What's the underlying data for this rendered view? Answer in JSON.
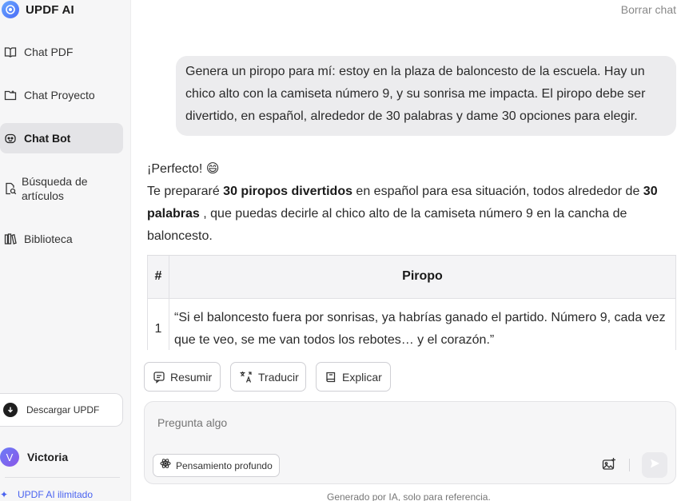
{
  "brand": {
    "name": "UPDF AI"
  },
  "sidebar": {
    "items": [
      {
        "label": "Chat PDF",
        "icon": "book-open-icon"
      },
      {
        "label": "Chat Proyecto",
        "icon": "folder-icon"
      },
      {
        "label": "Chat Bot",
        "icon": "bot-icon",
        "active": true
      },
      {
        "label_line1": "Búsqueda de",
        "label_line2": "artículos",
        "icon": "document-search-icon"
      },
      {
        "label": "Biblioteca",
        "icon": "library-icon"
      }
    ],
    "download_label": "Descargar UPDF",
    "user": {
      "initial": "V",
      "name": "Victoria"
    },
    "upgrade_label": "UPDF AI ilimitado"
  },
  "header": {
    "clear_chat": "Borrar chat"
  },
  "conversation": {
    "user_message": "Genera un piropo para mí: estoy en la plaza de baloncesto de la escuela. Hay un chico alto con la camiseta número 9, y su sonrisa me impacta. El piropo debe ser divertido, en español, alrededor de 30 palabras y dame 30 opciones para elegir.",
    "assistant": {
      "greeting": "¡Perfecto! 😄",
      "intro_1": "Te prepararé ",
      "intro_bold_1": "30 piropos divertidos",
      "intro_2": " en español para esa situación, todos alrededor de ",
      "intro_bold_2": "30 palabras",
      "intro_3": " , que puedas decirle al chico alto de la camiseta número 9 en la cancha de baloncesto."
    },
    "table": {
      "headers": [
        "#",
        "Piropo"
      ],
      "rows": [
        {
          "num": "1",
          "text": "“Si el baloncesto fuera por sonrisas, ya habrías ganado el partido. Número 9, cada vez que te veo, se me van todos los rebotes… y el corazón.”"
        }
      ]
    }
  },
  "actions": {
    "summarize": "Resumir",
    "translate": "Traducir",
    "explain": "Explicar"
  },
  "composer": {
    "placeholder": "Pregunta algo",
    "deep_thinking": "Pensamiento profundo"
  },
  "footer_note": "Generado por IA, solo para referencia."
}
